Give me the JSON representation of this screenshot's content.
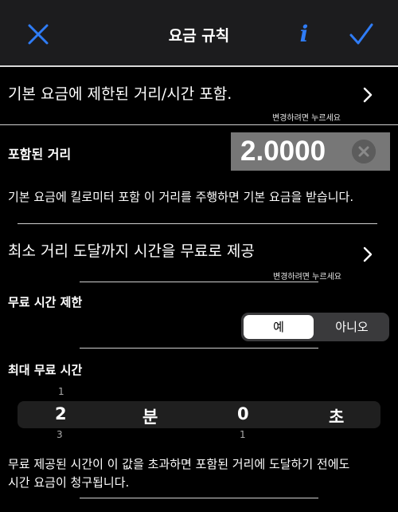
{
  "header": {
    "title": "요금 규칙",
    "info_icon_glyph": "i",
    "accent_color": "#2f7cf6"
  },
  "base_fare_row": {
    "label": "기본 요금에 제한된 거리/시간 포함.",
    "hint": "변경하려면 누르세요"
  },
  "included_distance": {
    "label": "포함된 거리",
    "value": "2.0000",
    "description": "기본 요금에 킬로미터 포함 이 거리를 주행하면 기본 요금을 받습니다."
  },
  "free_time_row": {
    "label": "최소 거리 도달까지 시간을 무료로 제공",
    "hint": "변경하려면 누르세요"
  },
  "free_time_limit": {
    "label": "무료 시간 제한",
    "options": [
      "예",
      "아니오"
    ],
    "selected": "예"
  },
  "max_free_time": {
    "label": "최대 무료 시간",
    "minutes": {
      "value": "2",
      "unit": "분",
      "prev": "1",
      "next": "3"
    },
    "seconds": {
      "value": "0",
      "unit": "초",
      "next": "1"
    }
  },
  "footer_note": {
    "line1": "무료 제공된 시간이 이 값을 초과하면 포함된 거리에 도달하기 전에도",
    "line2": "시간 요금이 청구됩니다."
  }
}
